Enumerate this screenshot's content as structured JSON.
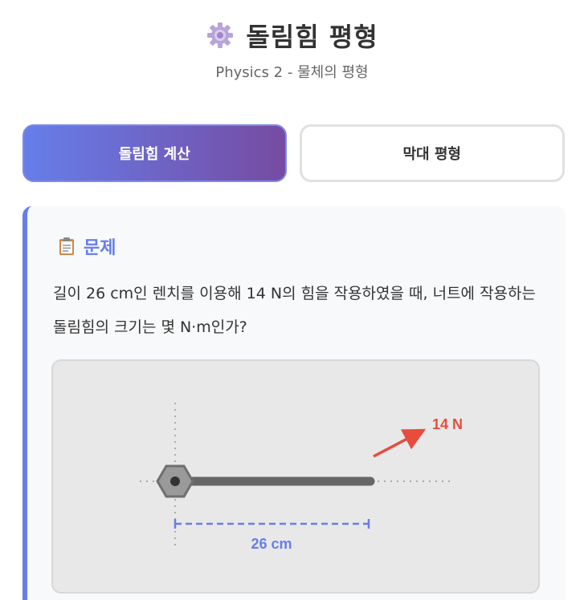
{
  "header": {
    "title": "돌림힘 평형",
    "subtitle": "Physics 2 - 물체의 평형",
    "icon": "gear-icon"
  },
  "tabs": [
    {
      "label": "돌림힘 계산",
      "active": true
    },
    {
      "label": "막대 평형",
      "active": false
    }
  ],
  "problem": {
    "icon": "clipboard-icon",
    "heading": "문제",
    "text": "길이 26 cm인 렌치를 이용해 14 N의 힘을 작용하였을 때, 너트에 작용하는 돌림힘의 크기는 몇 N·m인가?"
  },
  "diagram": {
    "force_label": "14 N",
    "length_label": "26 cm",
    "colors": {
      "force": "#e74c3c",
      "length": "#667eea",
      "wrench": "#666666",
      "nut": "#888888"
    }
  }
}
